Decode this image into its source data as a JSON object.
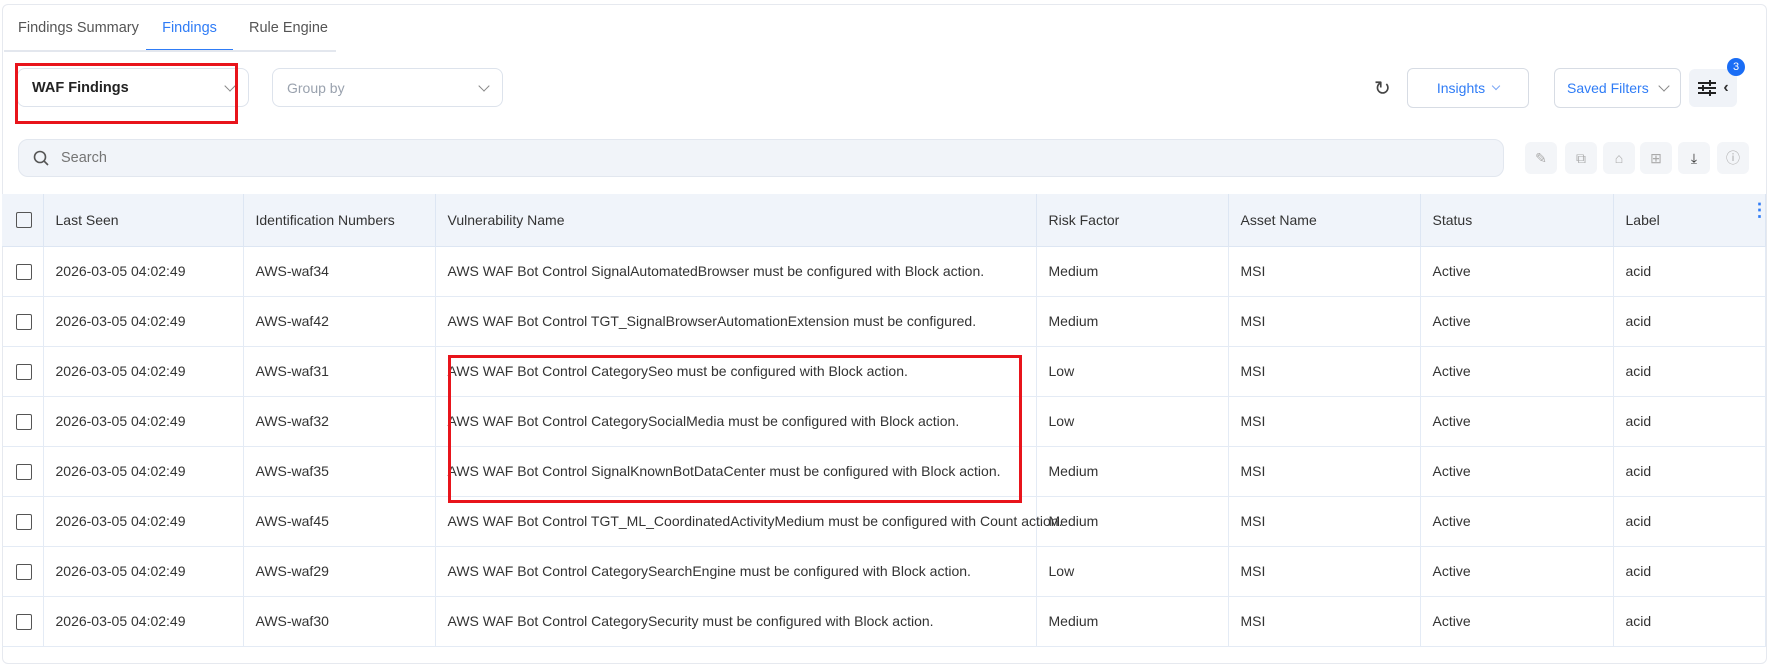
{
  "tabs": [
    {
      "label": "Findings Summary"
    },
    {
      "label": "Findings",
      "active": true
    },
    {
      "label": "Rule Engine"
    }
  ],
  "toolbar": {
    "view_select": "WAF Findings",
    "group_by_placeholder": "Group by",
    "insights_label": "Insights",
    "saved_filters_label": "Saved Filters",
    "filter_badge": "3"
  },
  "search": {
    "placeholder": "Search"
  },
  "table": {
    "headers": [
      "Last Seen",
      "Identification Numbers",
      "Vulnerability Name",
      "Risk Factor",
      "Asset Name",
      "Status",
      "Label"
    ],
    "rows": [
      [
        "2026-03-05 04:02:49",
        "AWS-waf34",
        "AWS WAF Bot Control SignalAutomatedBrowser must be configured with Block action.",
        "Medium",
        "MSI",
        "Active",
        "acid"
      ],
      [
        "2026-03-05 04:02:49",
        "AWS-waf42",
        "AWS WAF Bot Control TGT_SignalBrowserAutomationExtension must be configured.",
        "Medium",
        "MSI",
        "Active",
        "acid"
      ],
      [
        "2026-03-05 04:02:49",
        "AWS-waf31",
        "AWS WAF Bot Control CategorySeo must be configured with Block action.",
        "Low",
        "MSI",
        "Active",
        "acid"
      ],
      [
        "2026-03-05 04:02:49",
        "AWS-waf32",
        "AWS WAF Bot Control CategorySocialMedia must be configured with Block action.",
        "Low",
        "MSI",
        "Active",
        "acid"
      ],
      [
        "2026-03-05 04:02:49",
        "AWS-waf35",
        "AWS WAF Bot Control SignalKnownBotDataCenter must be configured with Block action.",
        "Medium",
        "MSI",
        "Active",
        "acid"
      ],
      [
        "2026-03-05 04:02:49",
        "AWS-waf45",
        "AWS WAF Bot Control TGT_ML_CoordinatedActivityMedium must be configured with Count action.",
        "Medium",
        "MSI",
        "Active",
        "acid"
      ],
      [
        "2026-03-05 04:02:49",
        "AWS-waf29",
        "AWS WAF Bot Control CategorySearchEngine must be configured with Block action.",
        "Low",
        "MSI",
        "Active",
        "acid"
      ],
      [
        "2026-03-05 04:02:49",
        "AWS-waf30",
        "AWS WAF Bot Control CategorySecurity must be configured with Block action.",
        "Medium",
        "MSI",
        "Active",
        "acid"
      ]
    ]
  },
  "colors": {
    "accent": "#2f7cf6",
    "highlight": "#e8141b"
  }
}
